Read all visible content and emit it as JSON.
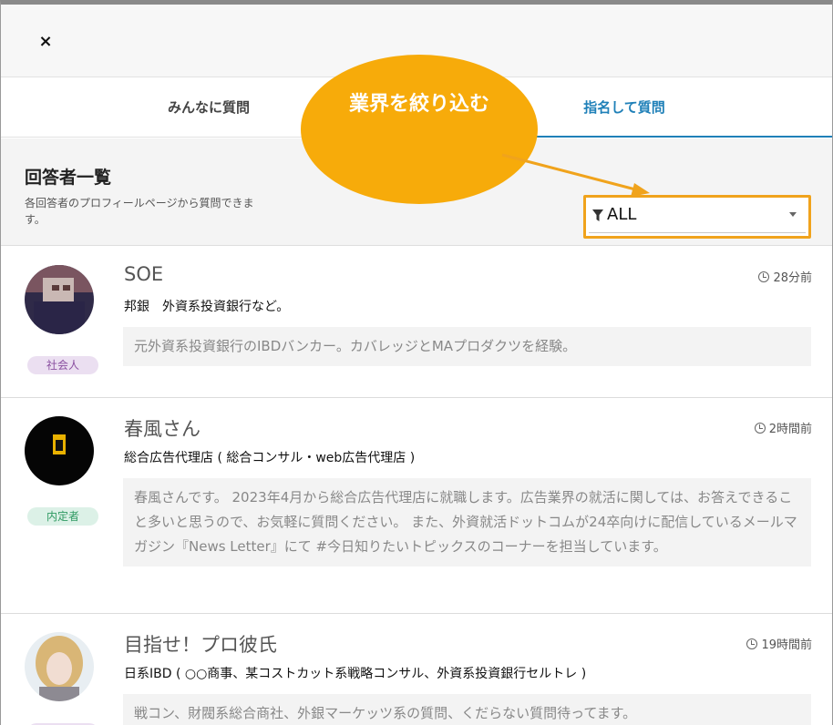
{
  "close_label": "×",
  "tabs": [
    {
      "label": "みんなに質問"
    },
    {
      "label": "指名して質問"
    }
  ],
  "header": {
    "title": "回答者一覧",
    "description": "各回答者のプロフィールページから質問できます。"
  },
  "filter": {
    "value": "ALL",
    "accent_color": "#f0a31c"
  },
  "callout": {
    "text": "業界を絞り込む",
    "color": "#f7ab0a"
  },
  "respondents": [
    {
      "name": "SOE",
      "time": "28分前",
      "badge": "社会人",
      "industry": "邦銀　外資系投資銀行など。",
      "bio": "元外資系投資銀行のIBDバンカー。カバレッジとMAプロダクツを経験。"
    },
    {
      "name": "春風さん",
      "time": "2時間前",
      "badge": "内定者",
      "industry": "総合広告代理店 ( 総合コンサル・web広告代理店 )",
      "bio": "春風さんです。 2023年4月から総合広告代理店に就職します。広告業界の就活に関しては、お答えできること多いと思うので、お気軽に質問ください。 また、外資就活ドットコムが24卒向けに配信しているメールマガジン『News Letter』にて #今日知りたいトピックスのコーナーを担当しています。"
    },
    {
      "name": "目指せ！プロ彼氏",
      "time": "19時間前",
      "badge": "",
      "industry": "日系IBD ( ○○商事、某コストカット系戦略コンサル、外資系投資銀行セルトレ )",
      "bio": "戦コン、財閥系総合商社、外銀マーケッツ系の質問、くだらない質問待ってます。"
    }
  ]
}
